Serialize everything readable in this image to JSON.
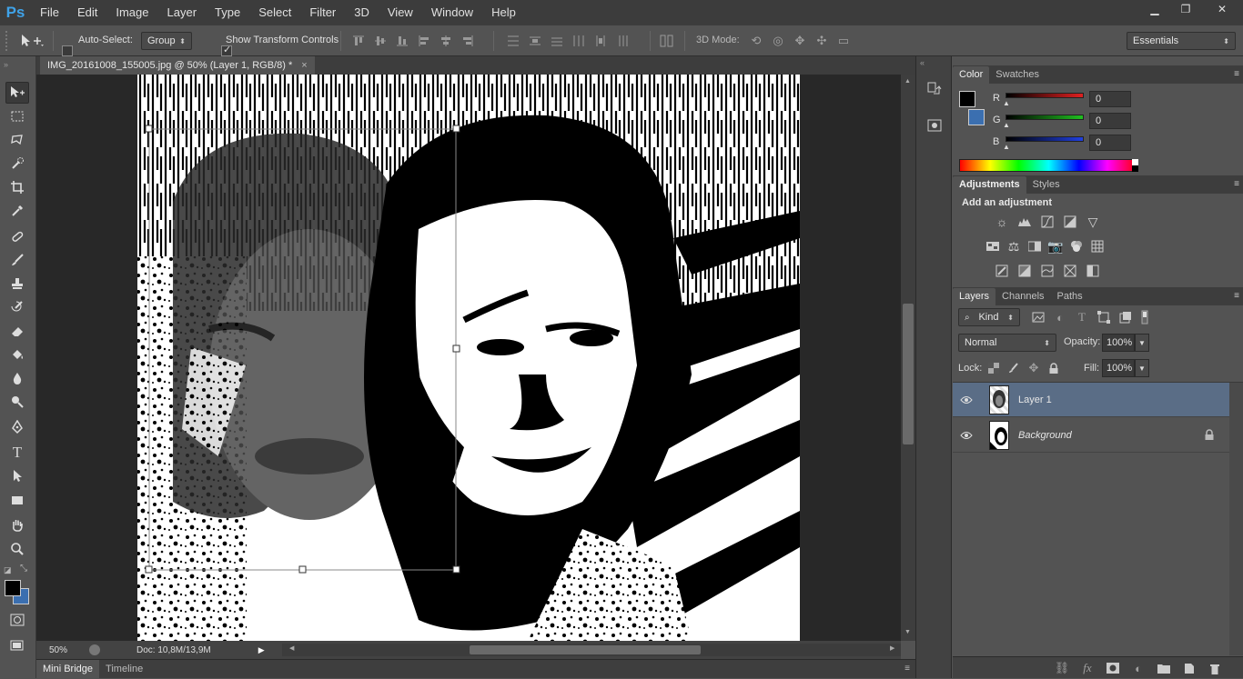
{
  "app": {
    "logo": "Ps"
  },
  "menu": [
    "File",
    "Edit",
    "Image",
    "Layer",
    "Type",
    "Select",
    "Filter",
    "3D",
    "View",
    "Window",
    "Help"
  ],
  "window_controls": {
    "minimize": "▁",
    "restore": "❐",
    "close": "✕"
  },
  "options": {
    "auto_select_label": "Auto-Select:",
    "auto_select_checked": false,
    "auto_select_value": "Group",
    "show_transform_label": "Show Transform Controls",
    "show_transform_checked": true,
    "mode_3d_label": "3D Mode:",
    "workspace": "Essentials"
  },
  "document": {
    "tab_title": "IMG_20161008_155005.jpg @ 50% (Layer 1, RGB/8) *",
    "close_glyph": "×",
    "zoom": "50%",
    "doc_info": "Doc: 10,8M/13,9M"
  },
  "bottom_tabs": [
    "Mini Bridge",
    "Timeline"
  ],
  "color_panel": {
    "tabs": [
      "Color",
      "Swatches"
    ],
    "channels": [
      {
        "label": "R",
        "value": "0",
        "color": "#e02020"
      },
      {
        "label": "G",
        "value": "0",
        "color": "#20c020"
      },
      {
        "label": "B",
        "value": "0",
        "color": "#2040e0"
      }
    ],
    "foreground": "#000000",
    "background": "#3b6fb0"
  },
  "adjustments_panel": {
    "tabs": [
      "Adjustments",
      "Styles"
    ],
    "heading": "Add an adjustment"
  },
  "layers_panel": {
    "tabs": [
      "Layers",
      "Channels",
      "Paths"
    ],
    "filter_kind": "Kind",
    "blend_mode": "Normal",
    "opacity_label": "Opacity:",
    "opacity_value": "100%",
    "lock_label": "Lock:",
    "fill_label": "Fill:",
    "fill_value": "100%",
    "layers": [
      {
        "name": "Layer 1",
        "selected": true,
        "italic": false,
        "locked": false
      },
      {
        "name": "Background",
        "selected": false,
        "italic": true,
        "locked": true
      }
    ]
  }
}
